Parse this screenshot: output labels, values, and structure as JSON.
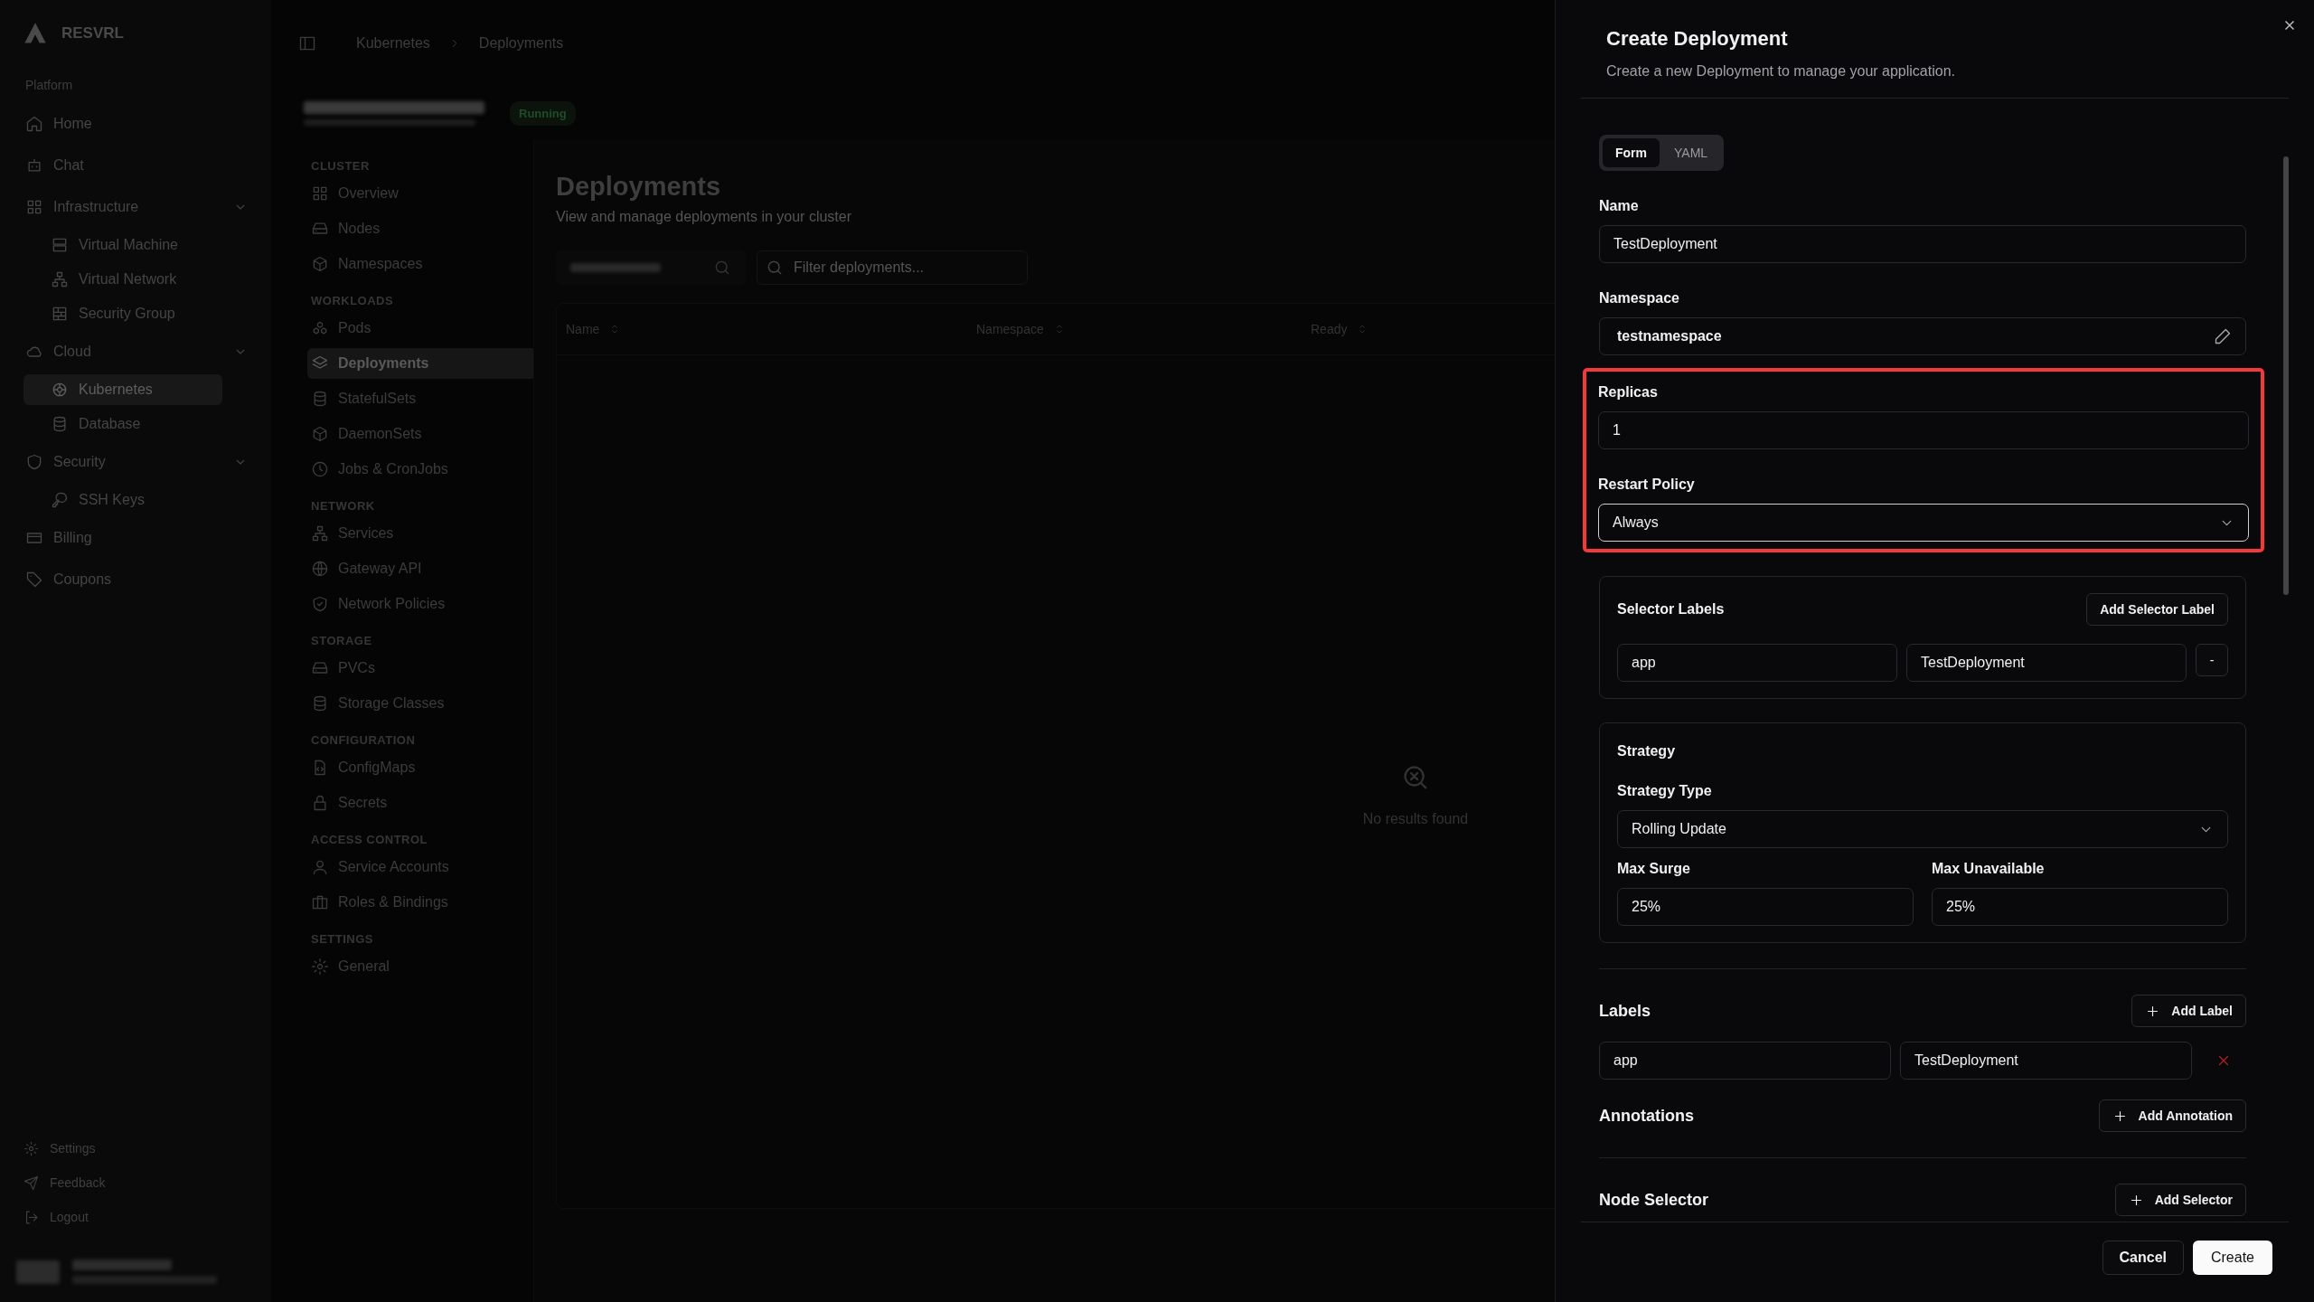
{
  "sidebar": {
    "brand": "RESVRL",
    "section": "Platform",
    "items": [
      {
        "label": "Home",
        "selected": false
      },
      {
        "label": "Chat",
        "selected": false
      },
      {
        "label": "Infrastructure",
        "selected": false,
        "expanded": true,
        "children": [
          {
            "label": "Virtual Machine",
            "selected": false
          },
          {
            "label": "Virtual Network",
            "selected": false
          },
          {
            "label": "Security Group",
            "selected": false
          }
        ]
      },
      {
        "label": "Cloud",
        "selected": false,
        "expanded": true,
        "children": [
          {
            "label": "Kubernetes",
            "selected": true
          },
          {
            "label": "Database",
            "selected": false
          }
        ]
      },
      {
        "label": "Security",
        "selected": false,
        "expanded": true,
        "children": [
          {
            "label": "SSH Keys",
            "selected": false
          }
        ]
      },
      {
        "label": "Billing",
        "selected": false
      },
      {
        "label": "Coupons",
        "selected": false
      }
    ],
    "footer": [
      "Settings",
      "Feedback",
      "Logout"
    ]
  },
  "breadcrumb": [
    "Kubernetes",
    "Deployments"
  ],
  "cluster": {
    "status": "Running"
  },
  "cluster_nav": [
    {
      "title": "CLUSTER",
      "items": [
        {
          "label": "Overview",
          "selected": false
        },
        {
          "label": "Nodes",
          "selected": false
        },
        {
          "label": "Namespaces",
          "selected": false
        }
      ]
    },
    {
      "title": "WORKLOADS",
      "items": [
        {
          "label": "Pods",
          "selected": false
        },
        {
          "label": "Deployments",
          "selected": true
        },
        {
          "label": "StatefulSets",
          "selected": false
        },
        {
          "label": "DaemonSets",
          "selected": false
        },
        {
          "label": "Jobs & CronJobs",
          "selected": false
        }
      ]
    },
    {
      "title": "NETWORK",
      "items": [
        {
          "label": "Services",
          "selected": false
        },
        {
          "label": "Gateway API",
          "selected": false
        },
        {
          "label": "Network Policies",
          "selected": false
        }
      ]
    },
    {
      "title": "STORAGE",
      "items": [
        {
          "label": "PVCs",
          "selected": false
        },
        {
          "label": "Storage Classes",
          "selected": false
        }
      ]
    },
    {
      "title": "CONFIGURATION",
      "items": [
        {
          "label": "ConfigMaps",
          "selected": false
        },
        {
          "label": "Secrets",
          "selected": false
        }
      ]
    },
    {
      "title": "ACCESS CONTROL",
      "items": [
        {
          "label": "Service Accounts",
          "selected": false
        },
        {
          "label": "Roles & Bindings",
          "selected": false
        }
      ]
    },
    {
      "title": "SETTINGS",
      "items": [
        {
          "label": "General",
          "selected": false
        }
      ]
    }
  ],
  "main": {
    "title": "Deployments",
    "subtitle": "View and manage deployments in your cluster",
    "filter_placeholder": "Filter deployments...",
    "columns": [
      "Name",
      "Namespace",
      "Ready"
    ],
    "empty": "No results found"
  },
  "dialog": {
    "title": "Create Deployment",
    "subtitle": "Create a new Deployment to manage your application.",
    "tabs": [
      {
        "label": "Form",
        "selected": true
      },
      {
        "label": "YAML",
        "selected": false
      }
    ],
    "fields": [
      {
        "label": "Name",
        "value": "TestDeployment",
        "kind": "text"
      },
      {
        "label": "Namespace",
        "value": "testnamespace",
        "kind": "editable"
      }
    ],
    "highlighted_fields": [
      {
        "label": "Replicas",
        "value": "1",
        "kind": "text"
      },
      {
        "label": "Restart Policy",
        "value": "Always",
        "kind": "select"
      }
    ],
    "selector_labels": {
      "title": "Selector Labels",
      "button": "Add Selector Label",
      "rows": [
        {
          "key": "app",
          "value": "TestDeployment",
          "remove": "-"
        }
      ]
    },
    "strategy": {
      "title": "Strategy",
      "type_label": "Strategy Type",
      "type_value": "Rolling Update",
      "fields": [
        {
          "label": "Max Surge",
          "value": "25%"
        },
        {
          "label": "Max Unavailable",
          "value": "25%"
        }
      ]
    },
    "labels": {
      "title": "Labels",
      "button": "Add Label",
      "rows": [
        {
          "key": "app",
          "value": "TestDeployment"
        }
      ]
    },
    "annotations": {
      "title": "Annotations",
      "button": "Add Annotation"
    },
    "node_selector": {
      "title": "Node Selector",
      "button": "Add Selector"
    },
    "cancel": "Cancel",
    "create": "Create"
  }
}
